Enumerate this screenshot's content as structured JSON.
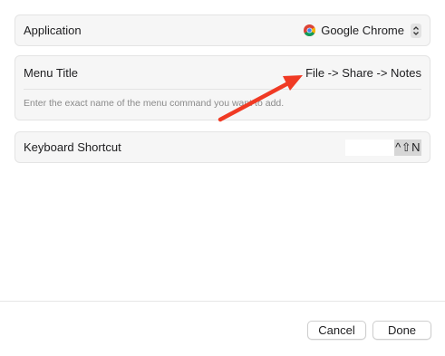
{
  "application": {
    "label": "Application",
    "value": "Google Chrome",
    "icon": "chrome-icon"
  },
  "menu_title": {
    "label": "Menu Title",
    "value": "File -> Share -> Notes",
    "help": "Enter the exact name of the menu command you want to add."
  },
  "keyboard_shortcut": {
    "label": "Keyboard Shortcut",
    "value": "^⇧N"
  },
  "buttons": {
    "cancel": "Cancel",
    "done": "Done"
  },
  "colors": {
    "annotation_arrow": "#f03a24",
    "card_background": "#f6f6f6"
  }
}
